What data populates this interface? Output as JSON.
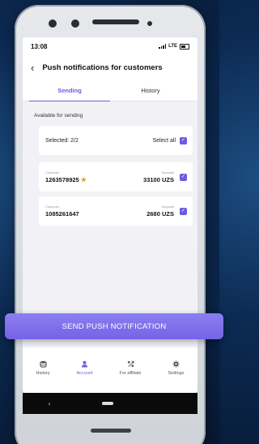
{
  "status": {
    "time": "13:08",
    "network": "LTE"
  },
  "header": {
    "title": "Push notifications for customers"
  },
  "tabs": [
    {
      "label": "Sending",
      "active": true
    },
    {
      "label": "History",
      "active": false
    }
  ],
  "section_label": "Available for sending",
  "selection": {
    "selected_text": "Selected: 2/2",
    "select_all_label": "Select all",
    "checked": true
  },
  "customers": [
    {
      "caption_left": "Customer",
      "id": "1263578925",
      "starred": true,
      "caption_right": "Deposits",
      "amount": "33100 UZS",
      "checked": true
    },
    {
      "caption_left": "Customer",
      "id": "1085261647",
      "starred": false,
      "caption_right": "Deposits",
      "amount": "2680 UZS",
      "checked": true
    }
  ],
  "send_button": {
    "label": "SEND PUSH NOTIFICATION"
  },
  "bottom_nav": [
    {
      "label": "History",
      "icon": "database-icon",
      "active": false
    },
    {
      "label": "Account",
      "icon": "user-icon",
      "active": true
    },
    {
      "label": "For affiliate",
      "icon": "affiliate-icon",
      "active": false
    },
    {
      "label": "Settings",
      "icon": "gear-icon",
      "active": false
    }
  ],
  "colors": {
    "accent": "#6a5ce0",
    "star": "#f59a1c",
    "background": "#0c2a52"
  }
}
